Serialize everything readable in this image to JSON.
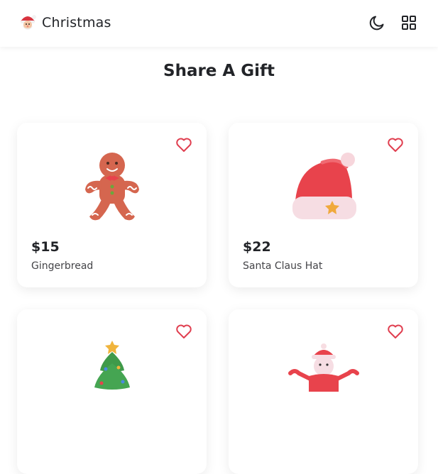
{
  "header": {
    "brand": "Christmas",
    "logo_icon": "santa-icon",
    "theme_icon": "moon-icon",
    "menu_icon": "grid-icon"
  },
  "main": {
    "title": "Share A Gift"
  },
  "accent_color": "#e03e4f",
  "products": [
    {
      "price": "$15",
      "name": "Gingerbread",
      "image_icon": "gingerbread-man-icon"
    },
    {
      "price": "$22",
      "name": "Santa Claus Hat",
      "image_icon": "santa-hat-icon"
    },
    {
      "price": "",
      "name": "",
      "image_icon": "christmas-tree-icon"
    },
    {
      "price": "",
      "name": "",
      "image_icon": "snowman-icon"
    }
  ]
}
